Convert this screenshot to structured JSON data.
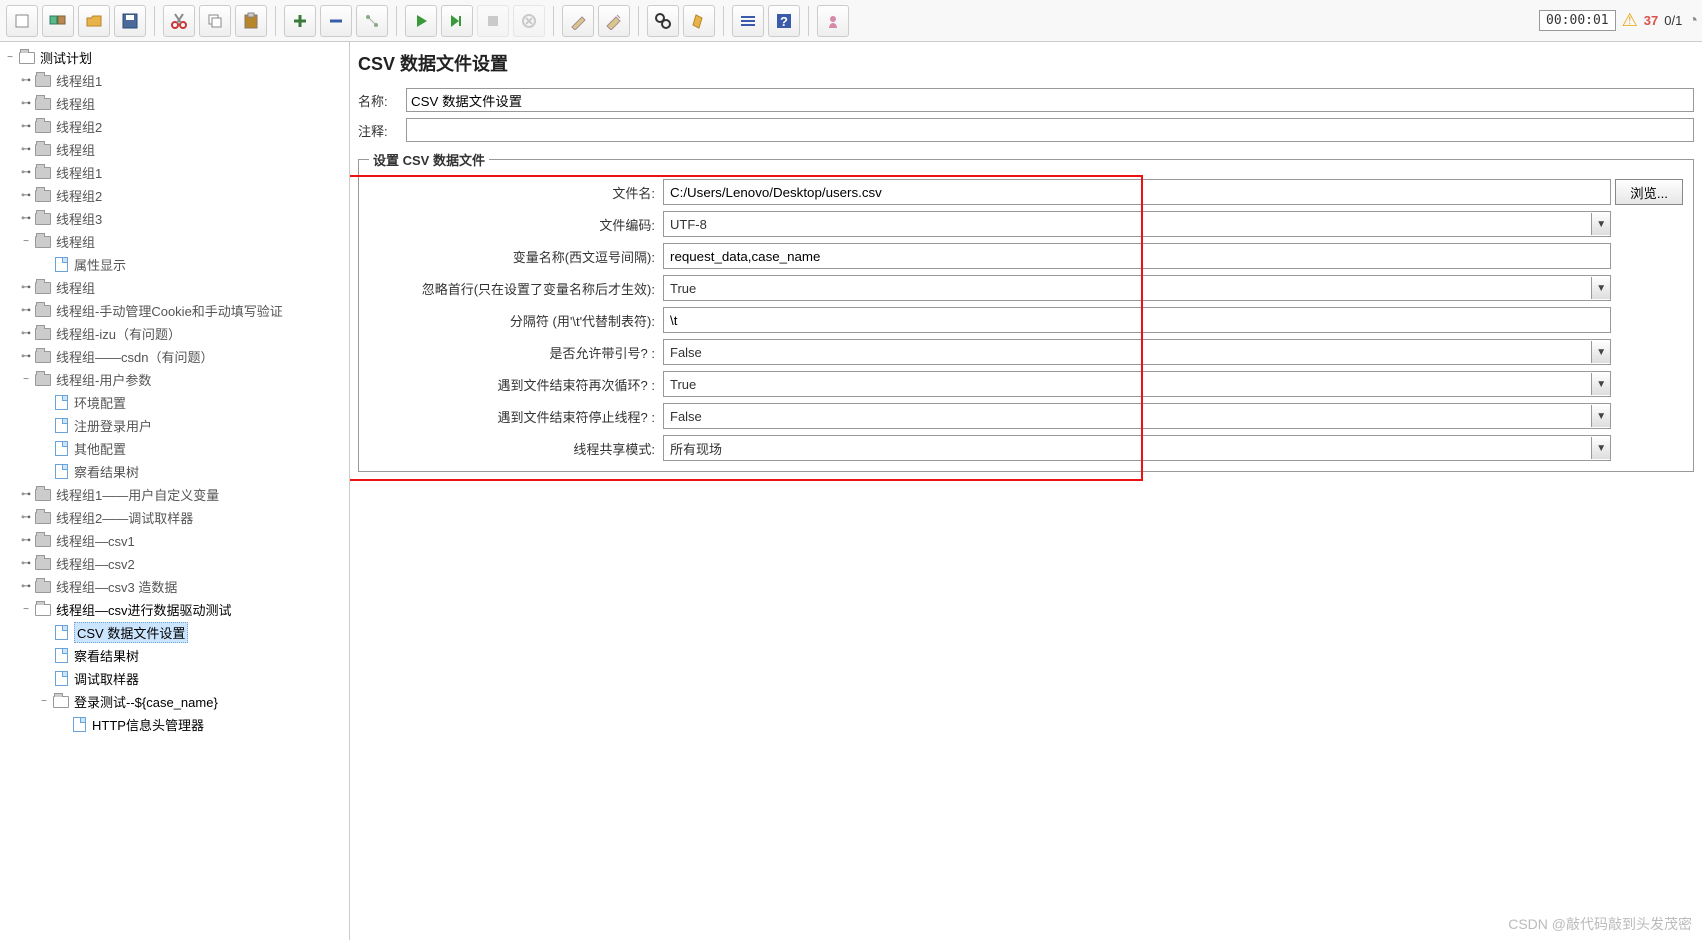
{
  "toolbar": {
    "timer": "00:00:01",
    "warn_count": "37",
    "thread_ratio": "0/1"
  },
  "tree": [
    {
      "lvl": 0,
      "t": "−",
      "ico": "folder-open",
      "txt": "测试计划",
      "bold": true
    },
    {
      "lvl": 1,
      "t": "⊶",
      "ico": "folder",
      "txt": "线程组1"
    },
    {
      "lvl": 1,
      "t": "⊶",
      "ico": "folder",
      "txt": "线程组"
    },
    {
      "lvl": 1,
      "t": "⊶",
      "ico": "folder",
      "txt": "线程组2"
    },
    {
      "lvl": 1,
      "t": "⊶",
      "ico": "folder",
      "txt": "线程组"
    },
    {
      "lvl": 1,
      "t": "⊶",
      "ico": "folder",
      "txt": "线程组1"
    },
    {
      "lvl": 1,
      "t": "⊶",
      "ico": "folder",
      "txt": "线程组2"
    },
    {
      "lvl": 1,
      "t": "⊶",
      "ico": "folder",
      "txt": "线程组3"
    },
    {
      "lvl": 1,
      "t": "−",
      "ico": "folder",
      "txt": "线程组"
    },
    {
      "lvl": 2,
      "t": "",
      "ico": "doc",
      "txt": "属性显示"
    },
    {
      "lvl": 1,
      "t": "⊶",
      "ico": "folder",
      "txt": "线程组"
    },
    {
      "lvl": 1,
      "t": "⊶",
      "ico": "folder",
      "txt": "线程组-手动管理Cookie和手动填写验证"
    },
    {
      "lvl": 1,
      "t": "⊶",
      "ico": "folder",
      "txt": "线程组-izu（有问题）"
    },
    {
      "lvl": 1,
      "t": "⊶",
      "ico": "folder",
      "txt": "线程组——csdn（有问题）"
    },
    {
      "lvl": 1,
      "t": "−",
      "ico": "folder",
      "txt": "线程组-用户参数"
    },
    {
      "lvl": 2,
      "t": "",
      "ico": "doc",
      "txt": "环境配置"
    },
    {
      "lvl": 2,
      "t": "",
      "ico": "doc",
      "txt": "注册登录用户"
    },
    {
      "lvl": 2,
      "t": "",
      "ico": "doc",
      "txt": "其他配置"
    },
    {
      "lvl": 2,
      "t": "",
      "ico": "doc",
      "txt": "察看结果树"
    },
    {
      "lvl": 1,
      "t": "⊶",
      "ico": "folder",
      "txt": "线程组1——用户自定义变量"
    },
    {
      "lvl": 1,
      "t": "⊶",
      "ico": "folder",
      "txt": "线程组2——调试取样器"
    },
    {
      "lvl": 1,
      "t": "⊶",
      "ico": "folder",
      "txt": "线程组—csv1"
    },
    {
      "lvl": 1,
      "t": "⊶",
      "ico": "folder",
      "txt": "线程组—csv2"
    },
    {
      "lvl": 1,
      "t": "⊶",
      "ico": "folder",
      "txt": "线程组—csv3 造数据"
    },
    {
      "lvl": 1,
      "t": "−",
      "ico": "folder-open",
      "txt": "线程组—csv进行数据驱动测试",
      "bold": true
    },
    {
      "lvl": 2,
      "t": "",
      "ico": "doc",
      "txt": "CSV 数据文件设置",
      "sel": true,
      "bold": true
    },
    {
      "lvl": 2,
      "t": "",
      "ico": "doc",
      "txt": "察看结果树",
      "bold": true
    },
    {
      "lvl": 2,
      "t": "",
      "ico": "doc",
      "txt": "调试取样器",
      "bold": true
    },
    {
      "lvl": 2,
      "t": "−",
      "ico": "folder-open",
      "txt": "登录测试--${case_name}",
      "bold": true
    },
    {
      "lvl": 3,
      "t": "",
      "ico": "doc",
      "txt": "HTTP信息头管理器",
      "bold": true
    }
  ],
  "panel": {
    "title": "CSV 数据文件设置",
    "name_label": "名称:",
    "name_value": "CSV 数据文件设置",
    "comment_label": "注释:",
    "comment_value": "",
    "fieldset_legend": "设置 CSV 数据文件",
    "browse_btn": "浏览...",
    "fields": [
      {
        "label": "文件名:",
        "value": "C:/Users/Lenovo/Desktop/users.csv",
        "type": "text",
        "browse": true
      },
      {
        "label": "文件编码:",
        "value": "UTF-8",
        "type": "select"
      },
      {
        "label": "变量名称(西文逗号间隔):",
        "value": "request_data,case_name",
        "type": "text"
      },
      {
        "label": "忽略首行(只在设置了变量名称后才生效):",
        "value": "True",
        "type": "select"
      },
      {
        "label": "分隔符 (用'\\t'代替制表符):",
        "value": "\\t",
        "type": "text"
      },
      {
        "label": "是否允许带引号? :",
        "value": "False",
        "type": "select"
      },
      {
        "label": "遇到文件结束符再次循环? :",
        "value": "True",
        "type": "select"
      },
      {
        "label": "遇到文件结束符停止线程? :",
        "value": "False",
        "type": "select"
      },
      {
        "label": "线程共享模式:",
        "value": "所有现场",
        "type": "select"
      }
    ]
  },
  "watermark": "CSDN @敲代码敲到头发茂密"
}
